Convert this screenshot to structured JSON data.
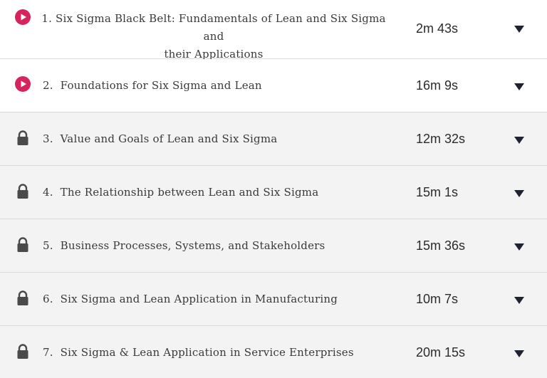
{
  "lessons": [
    {
      "number": "1.",
      "title_line1": "Six Sigma Black Belt: Fundamentals of Lean and Six Sigma and",
      "title_line2": "their Applications",
      "duration": "2m 43s",
      "status": "unlocked",
      "icon": "play-icon"
    },
    {
      "number": "2.",
      "title": "Foundations for Six Sigma and Lean",
      "duration": "16m 9s",
      "status": "unlocked",
      "icon": "play-icon"
    },
    {
      "number": "3.",
      "title": "Value and Goals of Lean and Six Sigma",
      "duration": "12m 32s",
      "status": "locked",
      "icon": "lock-icon"
    },
    {
      "number": "4.",
      "title": "The Relationship between Lean and Six Sigma",
      "duration": "15m 1s",
      "status": "locked",
      "icon": "lock-icon"
    },
    {
      "number": "5.",
      "title": "Business Processes, Systems, and Stakeholders",
      "duration": "15m 36s",
      "status": "locked",
      "icon": "lock-icon"
    },
    {
      "number": "6.",
      "title": "Six Sigma and Lean Application in Manufacturing",
      "duration": "10m 7s",
      "status": "locked",
      "icon": "lock-icon"
    },
    {
      "number": "7.",
      "title": "Six Sigma & Lean Application in Service Enterprises",
      "duration": "20m 15s",
      "status": "locked",
      "icon": "lock-icon"
    }
  ],
  "colors": {
    "play_accent": "#d6245e",
    "lock_icon": "#4a4a4a",
    "chevron": "#1f2230",
    "locked_row_bg": "#f3f3f3",
    "unlocked_row_bg": "#ffffff"
  }
}
